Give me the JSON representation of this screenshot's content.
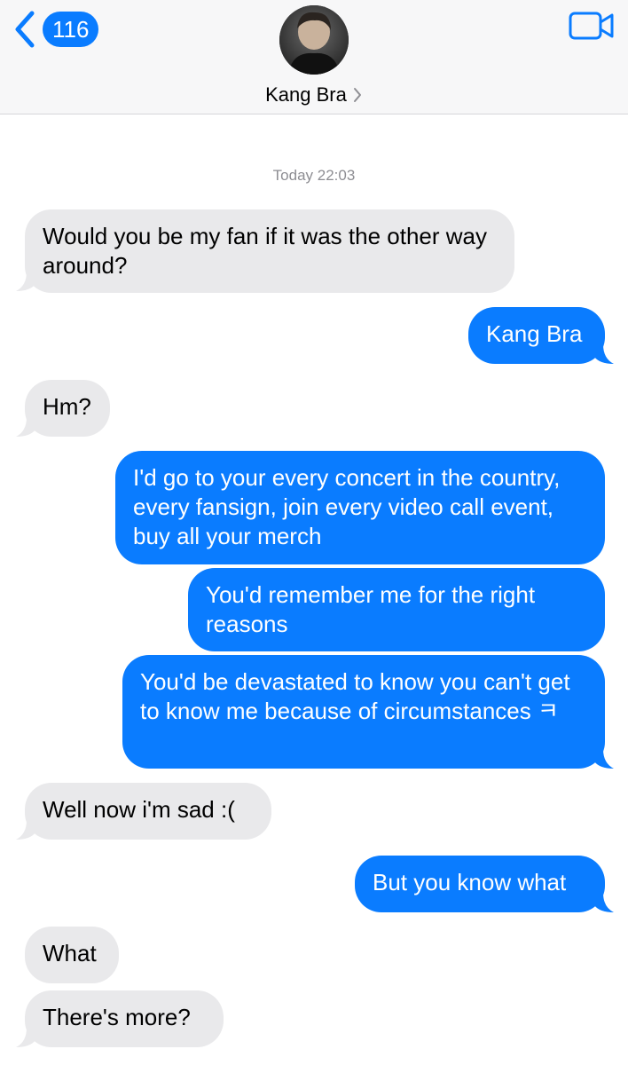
{
  "header": {
    "back_badge": "116",
    "contact_name": "Kang Bra"
  },
  "thread": {
    "timestamp": "Today 22:03",
    "messages": [
      {
        "side": "in",
        "text": "Would you be my fan if it was the other way around?"
      },
      {
        "side": "out",
        "text": "Kang Bra"
      },
      {
        "side": "in",
        "text": "Hm?"
      },
      {
        "side": "out",
        "text": "I'd go to your every concert in the country, every fansign, join every video call event, buy all your merch"
      },
      {
        "side": "out",
        "text": "You'd remember me for the right reasons"
      },
      {
        "side": "out",
        "text": "You'd be devastated to know you can't get to know me because of circumstances ㅋ"
      },
      {
        "side": "in",
        "text": "Well now i'm sad :("
      },
      {
        "side": "out",
        "text": "But you know what"
      },
      {
        "side": "in",
        "text": "What"
      },
      {
        "side": "in",
        "text": "There's more?"
      }
    ]
  },
  "colors": {
    "accent": "#0a7cff",
    "incoming_bubble": "#e9e9eb",
    "timestamp": "#8e8e93"
  },
  "icons": [
    "chevron-left-icon",
    "video-camera-icon",
    "chevron-right-icon"
  ]
}
